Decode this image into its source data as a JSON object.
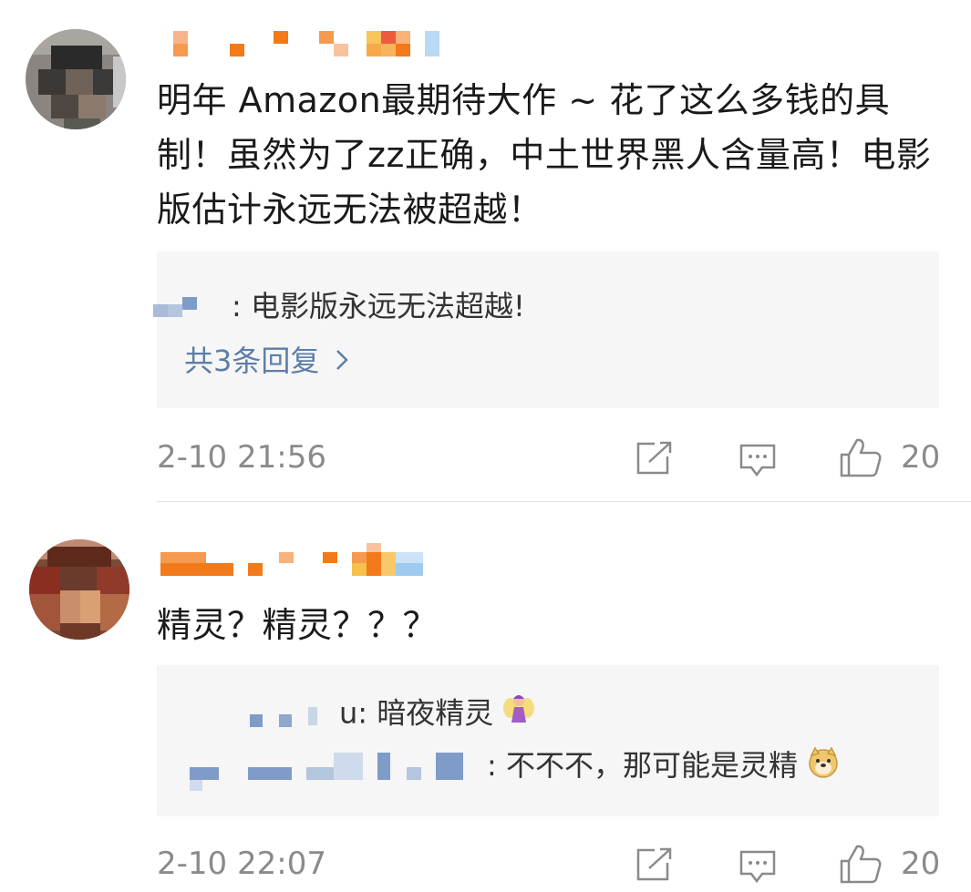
{
  "comments": [
    {
      "text": "明年 Amazon最期待大作 ~ 花了这么多钱的具制！虽然为了zz正确，中土世界黑人含量高！电影版估计永远无法被超越！",
      "replies": [
        {
          "text": ": 电影版永远无法超越!"
        }
      ],
      "more_replies": "共3条回复",
      "more_icon": "chevron-right-icon",
      "timestamp": "2-10 21:56",
      "likes": "20"
    },
    {
      "text": "精灵？精灵？？？",
      "replies": [
        {
          "text": "u: 暗夜精灵",
          "emoji": "fairy"
        },
        {
          "text": ": 不不不，那可能是灵精",
          "emoji": "doge"
        }
      ],
      "timestamp": "2-10 22:07",
      "likes": "20"
    }
  ],
  "icons": {
    "share": "share-icon",
    "comment": "comment-icon",
    "like": "thumbs-up-icon"
  },
  "colors": {
    "link": "#5d7ea8",
    "meta": "#8a8a8a",
    "reply_bg": "#f6f6f6"
  }
}
